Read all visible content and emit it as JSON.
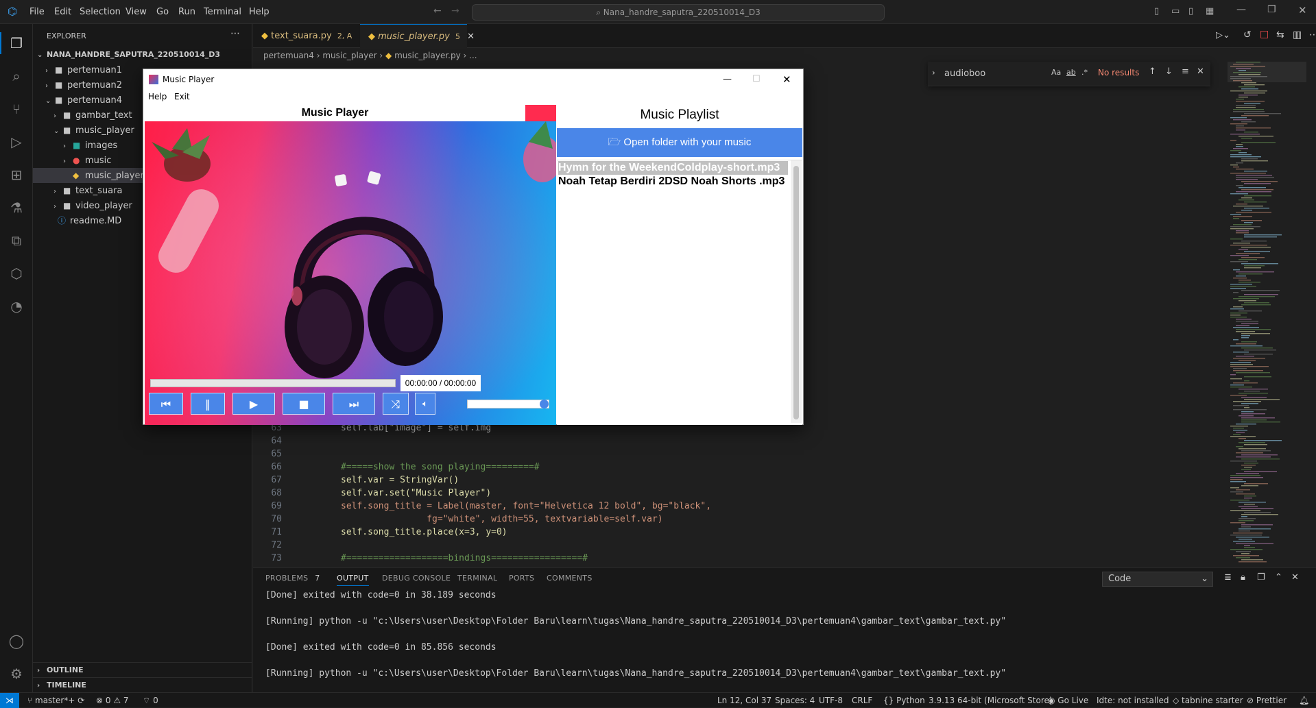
{
  "titlebar": {
    "menus": [
      "File",
      "Edit",
      "Selection",
      "View",
      "Go",
      "Run",
      "Terminal",
      "Help"
    ],
    "search": "Nana_handre_saputra_220510014_D3"
  },
  "explorer": {
    "header": "EXPLORER",
    "root": "NANA_HANDRE_SAPUTRA_220510014_D3",
    "items": [
      {
        "label": "pertemuan1"
      },
      {
        "label": "pertemuan2"
      },
      {
        "label": "pertemuan4"
      },
      {
        "label": "gambar_text"
      },
      {
        "label": "music_player"
      },
      {
        "label": "images"
      },
      {
        "label": "music"
      },
      {
        "label": "music_player.py"
      },
      {
        "label": "text_suara"
      },
      {
        "label": "video_player"
      },
      {
        "label": "readme.MD"
      }
    ],
    "outline": "OUTLINE",
    "timeline": "TIMELINE"
  },
  "tabs": [
    {
      "label": "text_suara.py",
      "badge": "2, A"
    },
    {
      "label": "music_player.py",
      "badge": "5"
    }
  ],
  "breadcrumb": [
    "pertemuan4",
    "music_player",
    "music_player.py",
    "..."
  ],
  "find": {
    "value": "audioboo",
    "options": [
      "Aa",
      "ab",
      ".*"
    ],
    "result": "No results"
  },
  "code": {
    "lines": [
      {
        "n": "63",
        "text": "self.lab[\"image\"] = self.img"
      },
      {
        "n": "64",
        "text": ""
      },
      {
        "n": "65",
        "text": ""
      },
      {
        "n": "66",
        "text": "#=====show the song playing=========#"
      },
      {
        "n": "67",
        "text": "self.var = StringVar()"
      },
      {
        "n": "68",
        "text": "self.var.set(\"Music Player\")"
      },
      {
        "n": "69",
        "text": "self.song_title = Label(master, font=\"Helvetica 12 bold\", bg=\"black\","
      },
      {
        "n": "70",
        "text": "                fg=\"white\", width=55, textvariable=self.var)"
      },
      {
        "n": "71",
        "text": "self.song_title.place(x=3, y=0)"
      },
      {
        "n": "72",
        "text": ""
      },
      {
        "n": "73",
        "text": "#===================bindings=================#"
      }
    ]
  },
  "panel": {
    "tabs": [
      "PROBLEMS",
      "OUTPUT",
      "DEBUG CONSOLE",
      "TERMINAL",
      "PORTS",
      "COMMENTS"
    ],
    "problems_count": "7",
    "channel": "Code",
    "output": [
      "[Done] exited with code=0 in 38.189 seconds",
      "",
      "[Running] python -u \"c:\\Users\\user\\Desktop\\Folder Baru\\learn\\tugas\\Nana_handre_saputra_220510014_D3\\pertemuan4\\gambar_text\\gambar_text.py\"",
      "",
      "[Done] exited with code=0 in 85.856 seconds",
      "",
      "[Running] python -u \"c:\\Users\\user\\Desktop\\Folder Baru\\learn\\tugas\\Nana_handre_saputra_220510014_D3\\pertemuan4\\gambar_text\\gambar_text.py\""
    ]
  },
  "statusbar": {
    "branch": "master*+",
    "errors": "0",
    "warnings": "7",
    "ports": "0",
    "position": "Ln 12, Col 37",
    "spaces": "Spaces: 4",
    "encoding": "UTF-8",
    "eol": "CRLF",
    "language": "Python",
    "interpreter": "3.9.13 64-bit (Microsoft Store)",
    "golive": "Go Live",
    "idte": "Idte: not installed",
    "tabnine": "tabnine starter",
    "prettier": "Prettier"
  },
  "music_player": {
    "window_title": "Music Player",
    "menus": [
      "Help",
      "Exit"
    ],
    "song_title": "Music Player",
    "time": "00:00:00 / 00:00:00",
    "progress": 0,
    "volume": 1.0,
    "playlist_title": "Music Playlist",
    "open_folder": "Open folder with your music",
    "playlist": [
      "Hymn for the WeekendColdplay-short.mp3",
      "Noah  Tetap Berdiri 2DSD Noah Shorts .mp3"
    ],
    "selected_index": 0,
    "colors": {
      "accent": "#4a86e8",
      "selection": "#c0c0c0"
    }
  }
}
